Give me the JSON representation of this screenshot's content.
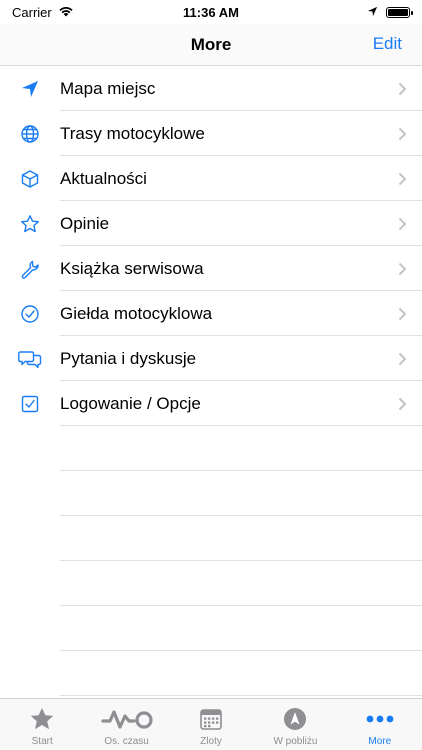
{
  "status_bar": {
    "carrier": "Carrier",
    "time": "11:36 AM"
  },
  "nav": {
    "title": "More",
    "edit_label": "Edit"
  },
  "colors": {
    "accent": "#1a7cf4",
    "inactive": "#8e8e93"
  },
  "menu": [
    {
      "label": "Mapa miejsc",
      "icon": "location-arrow-icon"
    },
    {
      "label": "Trasy motocyklowe",
      "icon": "globe-icon"
    },
    {
      "label": "Aktualności",
      "icon": "cube-icon"
    },
    {
      "label": "Opinie",
      "icon": "star-icon"
    },
    {
      "label": "Książka serwisowa",
      "icon": "wrench-icon"
    },
    {
      "label": "Giełda motocyklowa",
      "icon": "check-circle-icon"
    },
    {
      "label": "Pytania i dyskusje",
      "icon": "chat-bubbles-icon"
    },
    {
      "label": "Logowanie / Opcje",
      "icon": "checkbox-icon"
    }
  ],
  "tabs": [
    {
      "label": "Start",
      "icon": "star-filled-icon",
      "active": false
    },
    {
      "label": "Os. czasu",
      "icon": "pulse-icon",
      "active": false
    },
    {
      "label": "Zloty",
      "icon": "calendar-icon",
      "active": false
    },
    {
      "label": "W pobliżu",
      "icon": "compass-icon",
      "active": false
    },
    {
      "label": "More",
      "icon": "more-dots-icon",
      "active": true
    }
  ]
}
